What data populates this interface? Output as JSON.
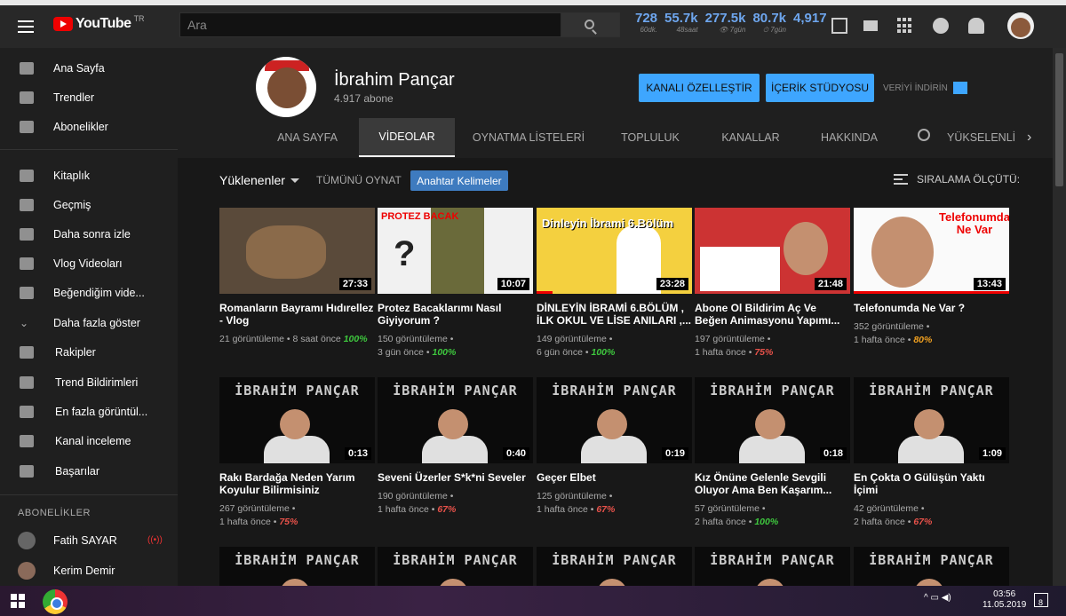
{
  "header": {
    "logo_text": "YouTube",
    "logo_region": "TR",
    "search_placeholder": "Ara",
    "stats": [
      {
        "value": "728",
        "sub": "60dk."
      },
      {
        "value": "55.7k",
        "sub": "48saat"
      },
      {
        "value": "277.5k",
        "sub": "👁 7gün"
      },
      {
        "value": "80.7k",
        "sub": "⏱ 7gün"
      },
      {
        "value": "4,917",
        "sub": ""
      }
    ]
  },
  "sidebar": {
    "items": [
      {
        "label": "Ana Sayfa",
        "icon": "home-icon"
      },
      {
        "label": "Trendler",
        "icon": "fire-icon"
      },
      {
        "label": "Abonelikler",
        "icon": "subscriptions-icon"
      },
      {
        "label": "Kitaplık",
        "icon": "folder-icon"
      },
      {
        "label": "Geçmiş",
        "icon": "history-icon"
      },
      {
        "label": "Daha sonra izle",
        "icon": "clock-icon"
      },
      {
        "label": "Vlog Videoları",
        "icon": "playlist-icon"
      },
      {
        "label": "Beğendiğim vide...",
        "icon": "thumb-up-icon"
      },
      {
        "label": "Daha fazla göster",
        "icon": "chevron-down-icon"
      },
      {
        "label": "Rakipler",
        "icon": "play-box-icon"
      },
      {
        "label": "Trend Bildirimleri",
        "icon": "play-box-icon"
      },
      {
        "label": "En fazla görüntül...",
        "icon": "play-box-icon"
      },
      {
        "label": "Kanal inceleme",
        "icon": "play-box-icon"
      },
      {
        "label": "Başarılar",
        "icon": "play-box-icon"
      }
    ],
    "subscriptions_heading": "ABONELİKLER",
    "subscriptions": [
      {
        "name": "Fatih SAYAR",
        "live": "((•))"
      },
      {
        "name": "Kerim Demir",
        "live": ""
      }
    ]
  },
  "channel": {
    "name": "İbrahim Pançar",
    "subscribers": "4.917 abone",
    "customize_button": "KANALI ÖZELLEŞTİR",
    "studio_button": "İÇERİK STÜDYOSU",
    "download_label": "VERİYİ İNDİRİN",
    "tabs": [
      "ANA SAYFA",
      "VİDEOLAR",
      "OYNATMA LİSTELERİ",
      "TOPLULUK",
      "KANALLAR",
      "HAKKINDA",
      "YÜKSELENLİ"
    ],
    "active_tab": "VİDEOLAR"
  },
  "controls": {
    "uploads_label": "Yüklenenler",
    "play_all": "TÜMÜNÜ OYNAT",
    "keywords_button": "Anahtar Kelimeler",
    "sort_label": "SIRALAMA ÖLÇÜTÜ:"
  },
  "brand_text": "İBRAHİM PANÇAR",
  "videos": [
    {
      "title": "Romanların Bayramı Hıdırellez - Vlog",
      "views": "21 görüntüleme",
      "age": "8 saat önce",
      "pct": "100%",
      "pct_color": "#3ec73e",
      "duration": "27:33",
      "progress": 0
    },
    {
      "title": "Protez Bacaklarımı Nasıl Giyiyorum ?",
      "views": "150 görüntüleme",
      "age": "3 gün önce",
      "pct": "100%",
      "pct_color": "#3ec73e",
      "duration": "10:07",
      "progress": 0
    },
    {
      "title": "DİNLEYİN İBRAMİ 6.BÖLÜM , İLK OKUL VE LİSE ANILARI ,...",
      "views": "149 görüntüleme",
      "age": "6 gün önce",
      "pct": "100%",
      "pct_color": "#3ec73e",
      "duration": "23:28",
      "progress": 0.1
    },
    {
      "title": "Abone Ol Bildirim Aç Ve Beğen Animasyonu Yapımı...",
      "views": "197 görüntüleme",
      "age": "1 hafta önce",
      "pct": "75%",
      "pct_color": "#e8524a",
      "duration": "21:48",
      "progress": 0
    },
    {
      "title": "Telefonumda Ne Var ?",
      "views": "352 görüntüleme",
      "age": "1 hafta önce",
      "pct": "80%",
      "pct_color": "#f0a020",
      "duration": "13:43",
      "progress": 1
    },
    {
      "title": "Rakı Bardağa Neden Yarım Koyulur Bilirmisiniz",
      "views": "267 görüntüleme",
      "age": "1 hafta önce",
      "pct": "75%",
      "pct_color": "#e8524a",
      "duration": "0:13",
      "progress": 0
    },
    {
      "title": "Seveni Üzerler S*k*ni Seveler",
      "views": "190 görüntüleme",
      "age": "1 hafta önce",
      "pct": "67%",
      "pct_color": "#e8524a",
      "duration": "0:40",
      "progress": 0
    },
    {
      "title": "Geçer Elbet",
      "views": "125 görüntüleme",
      "age": "1 hafta önce",
      "pct": "67%",
      "pct_color": "#e8524a",
      "duration": "0:19",
      "progress": 0
    },
    {
      "title": "Kız Önüne Gelenle Sevgili Oluyor Ama Ben Kaşarım...",
      "views": "57 görüntüleme",
      "age": "2 hafta önce",
      "pct": "100%",
      "pct_color": "#3ec73e",
      "duration": "0:18",
      "progress": 0
    },
    {
      "title": "En Çokta O Gülüşün Yaktı İçimi",
      "views": "42 görüntüleme",
      "age": "2 hafta önce",
      "pct": "67%",
      "pct_color": "#e8524a",
      "duration": "1:09",
      "progress": 0
    }
  ],
  "thumb_texts": {
    "t2": "PROTEZ BACAK",
    "t3": "Dinleyin İbrami 6.Bölüm",
    "t5": "Telefonumda Ne Var"
  },
  "taskbar": {
    "time": "03:56",
    "date": "11.05.2019",
    "notifications": "8"
  }
}
